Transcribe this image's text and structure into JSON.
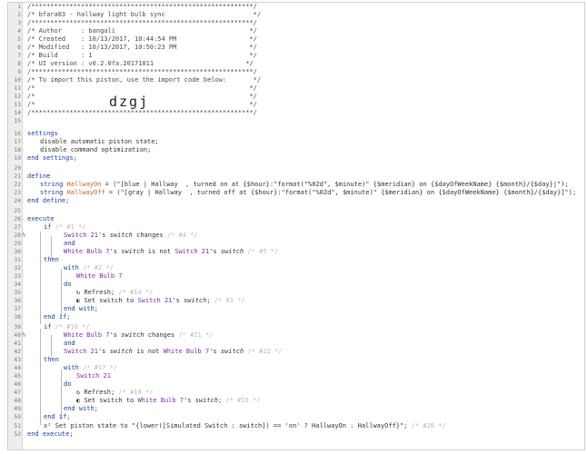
{
  "header": {
    "stars": "/**********************************************************/",
    "title": "/* bfara83 - hallway light bulb sync                       */",
    "author": "/* Author     : bangali                                   */",
    "created": "/* Created    : 10/13/2017, 10:44:54 PM                   */",
    "modified": "/* Modified   : 10/13/2017, 10:50:23 PM                   */",
    "build": "/* Build      : 1                                         */",
    "ui_version": "/* UI version : v0.2.0fa.20171011                        */",
    "import_note": "/* To import this piston, use the import code below:       */",
    "blank": "/*                                                        */",
    "import_code": "dzgj"
  },
  "settings": {
    "kw_settings": "settings",
    "line1": "disable automatic piston state;",
    "line2": "disable command optimization;",
    "end": "end settings;"
  },
  "define": {
    "kw": "define",
    "type": "string",
    "var_on": "HallwayOn",
    "val_on": " = (\"[blue | Hallway  , turned on at {$hour}:\"format(\"%02d\", $minute)\" {$meridian} on {$dayOfWeekName} {$month}/{$day}|\");",
    "var_off": "HallwayOff",
    "val_off": " = (\"[gray | Hallway  , turned off at {$hour}:\"format(\"%02d\", $minute)\" {$meridian} on {$dayOfWeekName} {$month}/{$day}]\");",
    "end": "end define;"
  },
  "execute": {
    "kw": "execute",
    "if": "if",
    "and": "and",
    "then": "then",
    "with": "with",
    "do": "do",
    "end_with": "end with;",
    "end_if": "end if;",
    "end_execute": "end execute;",
    "switch21": "Switch 21",
    "bulb7": "White Bulb 7",
    "possessive": "'s ",
    "attr_switch": "switch",
    "changes": " changes ",
    "is_not": " is not ",
    "refresh": "Refresh;",
    "set_switch_to": "Set switch to ",
    "set_piston_state": "Set piston state to ",
    "piston_state_expr": "\"{lower([Simulated Switch : switch]) == 'on' ? HallwayOn : HallwayOff}\";",
    "ids": {
      "s1": "/* #1 */",
      "s4": "/* #4 */",
      "s5": "/* #5 */",
      "s2": "/* #2 */",
      "s14": "/* #14 */",
      "s3": "/* #3 */",
      "s16": "/* #16 */",
      "s21": "/* #21 */",
      "s22": "/* #22 */",
      "s17": "/* #17 */",
      "s18": "/* #18 */",
      "s19": "/* #19 */",
      "s20": "/* #20 */"
    }
  },
  "line_numbers": [
    "1",
    "2",
    "3",
    "4",
    "5",
    "6",
    "7",
    "8",
    "9",
    "10",
    "11",
    "12",
    "13",
    "14",
    "15",
    "16",
    "17",
    "18",
    "19",
    "20",
    "21",
    "22",
    "23",
    "24",
    "25",
    "26",
    "27",
    "28",
    "29",
    "30",
    "31",
    "32",
    "33",
    "34",
    "35",
    "36",
    "37",
    "38",
    "39",
    "40",
    "41",
    "42",
    "43",
    "44",
    "45",
    "46",
    "47",
    "48",
    "49",
    "50",
    "51",
    "52"
  ]
}
